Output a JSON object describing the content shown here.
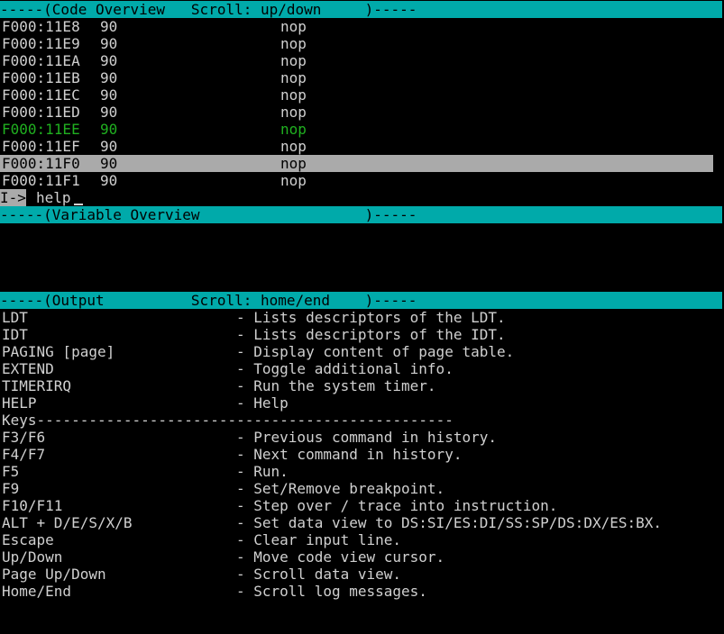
{
  "code_overview": {
    "header": "-----(Code Overview   Scroll: up/down     )-----",
    "rows": [
      {
        "address": "F000:11E8",
        "bytes": "90",
        "instruction": "nop"
      },
      {
        "address": "F000:11E9",
        "bytes": "90",
        "instruction": "nop"
      },
      {
        "address": "F000:11EA",
        "bytes": "90",
        "instruction": "nop"
      },
      {
        "address": "F000:11EB",
        "bytes": "90",
        "instruction": "nop"
      },
      {
        "address": "F000:11EC",
        "bytes": "90",
        "instruction": "nop"
      },
      {
        "address": "F000:11ED",
        "bytes": "90",
        "instruction": "nop"
      },
      {
        "address": "F000:11EE",
        "bytes": "90",
        "instruction": "nop"
      },
      {
        "address": "F000:11EF",
        "bytes": "90",
        "instruction": "nop"
      },
      {
        "address": "F000:11F0",
        "bytes": "90",
        "instruction": "nop"
      },
      {
        "address": "F000:11F1",
        "bytes": "90",
        "instruction": "nop"
      }
    ]
  },
  "command_line": {
    "prompt": "I->",
    "input_value": "help"
  },
  "variable_overview": {
    "header": "-----(Variable Overview                   )-----"
  },
  "output": {
    "header": "-----(Output          Scroll: home/end    )-----",
    "lines": [
      {
        "key": "LDT",
        "desc": "- Lists descriptors of the LDT."
      },
      {
        "key": "IDT",
        "desc": "- Lists descriptors of the IDT."
      },
      {
        "key": "PAGING [page]",
        "desc": "- Display content of page table."
      },
      {
        "key": "EXTEND",
        "desc": "- Toggle additional info."
      },
      {
        "key": "TIMERIRQ",
        "desc": "- Run the system timer."
      },
      {
        "key": "HELP",
        "desc": "- Help"
      },
      {
        "key": "Keys------------------------------------------------",
        "desc": ""
      },
      {
        "key": "F3/F6",
        "desc": "- Previous command in history."
      },
      {
        "key": "F4/F7",
        "desc": "- Next command in history."
      },
      {
        "key": "F5",
        "desc": "- Run."
      },
      {
        "key": "F9",
        "desc": "- Set/Remove breakpoint."
      },
      {
        "key": "F10/F11",
        "desc": "- Step over / trace into instruction."
      },
      {
        "key": "ALT + D/E/S/X/B",
        "desc": "- Set data view to DS:SI/ES:DI/SS:SP/DS:DX/ES:BX."
      },
      {
        "key": "Escape",
        "desc": "- Clear input line."
      },
      {
        "key": "Up/Down",
        "desc": "- Move code view cursor."
      },
      {
        "key": "Page Up/Down",
        "desc": "- Scroll data view."
      },
      {
        "key": "Home/End",
        "desc": "- Scroll log messages."
      }
    ]
  },
  "colors": {
    "header_bar": "#00aaaa",
    "text": "#d0d0d0",
    "current_instruction": "#20b020",
    "selected_row": "#aaaaaa",
    "background": "#000000"
  }
}
